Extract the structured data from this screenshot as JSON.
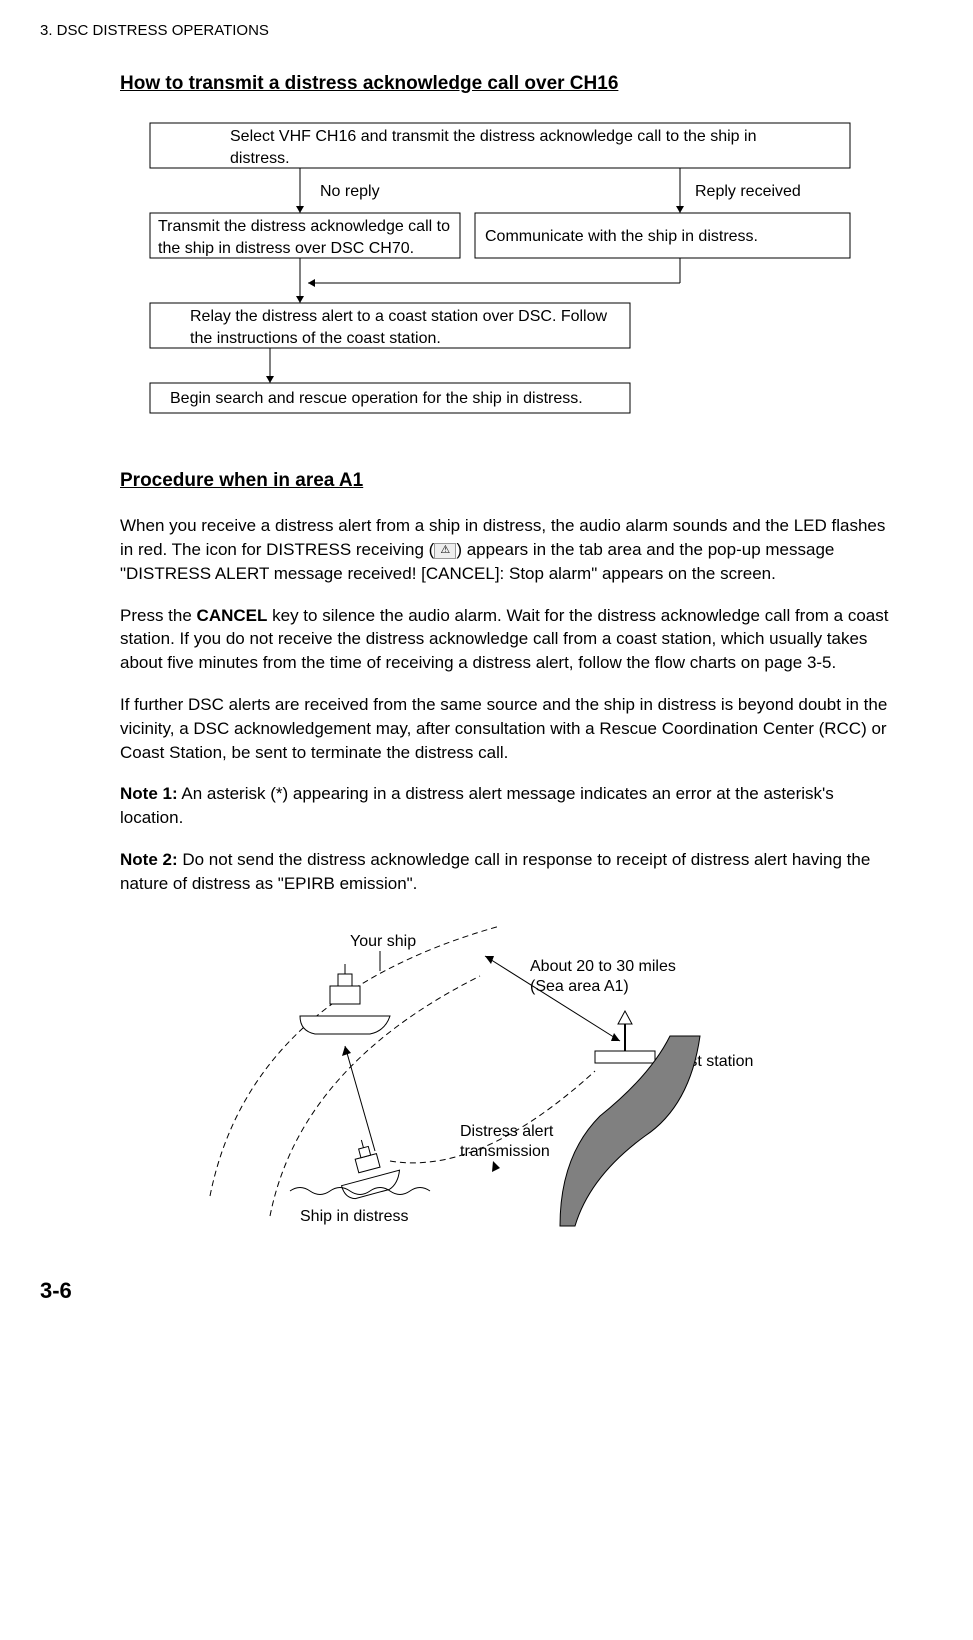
{
  "header": {
    "chapterLabel": "3.  DSC DISTRESS OPERATIONS"
  },
  "section1": {
    "title": "How to transmit a distress acknowledge call over CH16"
  },
  "flowchart": {
    "box1": "Select VHF CH16 and transmit the distress acknowledge call to the ship in distress.",
    "labelNoReply": "No reply",
    "labelReplyReceived": "Reply received",
    "box2": "Transmit the distress acknowledge call to the ship in distress over DSC CH70.",
    "box3": "Communicate with the ship in distress.",
    "box4": "Relay the distress alert to a coast station over DSC. Follow the instructions of the coast station.",
    "box5": "Begin search and rescue operation for the ship in distress."
  },
  "section2": {
    "title": "Procedure when in area A1"
  },
  "paragraphs": {
    "p1a": "When you receive a distress alert from a ship in distress, the audio alarm sounds and the LED flashes in red. The icon for DISTRESS receiving (",
    "p1b": ") appears in the tab area and the pop-up message \"DISTRESS ALERT message received! [CANCEL]: Stop alarm\" appears on the screen.",
    "p2a": "Press the ",
    "p2bold": "CANCEL",
    "p2b": " key to silence the audio alarm. Wait for the distress acknowledge call from a coast station. If you do not receive the distress acknowledge call from a coast station, which usually takes about five minutes from the time of receiving a distress alert, follow the flow charts on page 3-5.",
    "p3": "If further DSC alerts are received from the same source and the ship in distress is beyond doubt in the vicinity, a DSC acknowledgement may, after consultation with a Rescue Coordination Center (RCC) or Coast Station, be sent to terminate the distress call.",
    "note1label": "Note 1:",
    "note1text": " An asterisk (*) appearing in a distress alert message indicates an error at the asterisk's location.",
    "note2label": "Note 2:",
    "note2text": " Do not send the distress acknowledge call in response to receipt of distress alert having the nature of distress as \"EPIRB emission\"."
  },
  "diagram": {
    "yourShip": "Your ship",
    "distance": "About 20 to 30 miles",
    "area": "(Sea area A1)",
    "coastStation": "Coast station",
    "distressAlert1": "Distress alert",
    "distressAlert2": "transmission",
    "shipInDistress": "Ship in distress"
  },
  "footer": {
    "pageNum": "3-6"
  }
}
